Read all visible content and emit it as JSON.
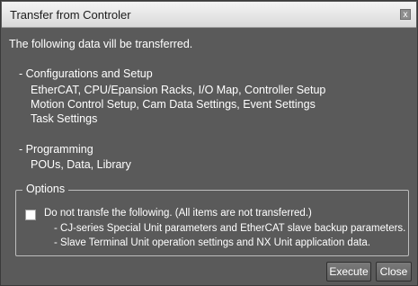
{
  "window": {
    "title": "Transfer from Controler",
    "close_glyph": "x"
  },
  "content": {
    "intro": "The following data vill be transferred.",
    "config_heading": "- Configurations and Setup",
    "config_lines": [
      "EtherCAT, CPU/Epansion Racks, I/O Map, Controller Setup",
      "Motion Control Setup, Cam Data Settings, Event Settings",
      "Task Settings"
    ],
    "programming_heading": "- Programming",
    "programming_line": "POUs, Data, Library"
  },
  "options": {
    "legend": "Options",
    "checkbox_checked": false,
    "checkbox_label": "Do not transfe the following. (All items are not transferred.)",
    "sub_items": [
      "- CJ-series Special Unit parameters and EtherCAT slave backup parameters.",
      "- Slave Terminal Unit operation settings and NX Unit application data."
    ]
  },
  "buttons": {
    "execute": "Execute",
    "close": "Close"
  },
  "colors": {
    "dialog_background": "#5a5a5a",
    "titlebar": "#e6e6e6",
    "text": "#ffffff"
  }
}
